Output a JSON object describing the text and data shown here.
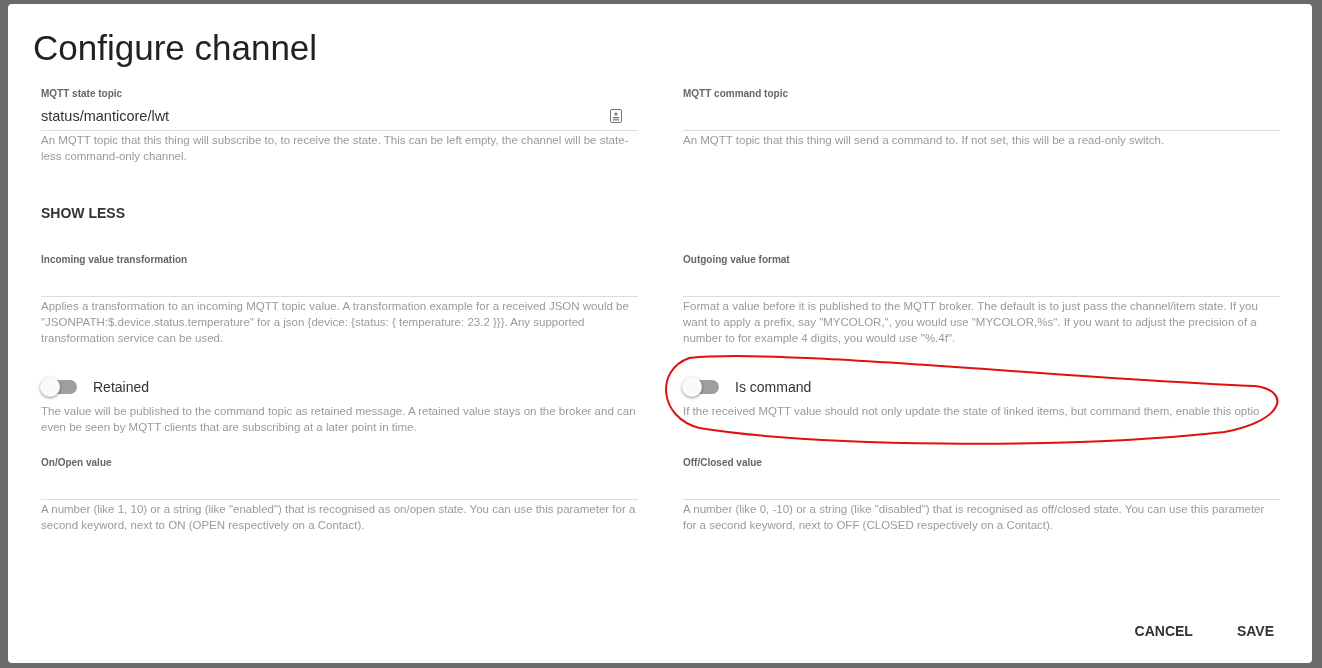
{
  "dialog": {
    "title": "Configure channel"
  },
  "top_fields": [
    {
      "kind": "text",
      "label": "MQTT state topic",
      "value": "status/manticore/lwt",
      "has_icon": true,
      "help": "An MQTT topic that this thing will subscribe to, to receive the state. This can be left empty, the channel will be state-less command-only channel."
    },
    {
      "kind": "text",
      "label": "MQTT command topic",
      "help": "An MQTT topic that this thing will send a command to. If not set, this will be a read-only switch."
    }
  ],
  "toggle_link": "SHOW LESS",
  "advanced_fields": [
    {
      "kind": "text",
      "label": "Incoming value transformation",
      "help": "Applies a transformation to an incoming MQTT topic value. A transformation example for a received JSON would be \"JSONPATH:$.device.status.temperature\" for a json {device: {status: { temperature: 23.2 }}}. Any supported transformation service can be used."
    },
    {
      "kind": "text",
      "label": "Outgoing value format",
      "help": "Format a value before it is published to the MQTT broker. The default is to just pass the channel/item state. If you want to apply a prefix, say \"MYCOLOR,\", you would use \"MYCOLOR,%s\". If you want to adjust the precision of a number to for example 4 digits, you would use \"%.4f\"."
    },
    {
      "kind": "switch",
      "label": "Retained",
      "on": false,
      "help": "The value will be published to the command topic as retained message. A retained value stays on the broker and can even be seen by MQTT clients that are subscribing at a later point in time."
    },
    {
      "kind": "switch",
      "label": "Is command",
      "on": false,
      "highlighted": true,
      "help": "If the received MQTT value should not only update the state of linked items, but command them, enable this optio"
    },
    {
      "kind": "text",
      "label": "On/Open value",
      "help": "A number (like 1, 10) or a string (like \"enabled\") that is recognised as on/open state. You can use this parameter for a second keyword, next to ON (OPEN respectively on a Contact)."
    },
    {
      "kind": "text",
      "label": "Off/Closed value",
      "help": "A number (like 0, -10) or a string (like \"disabled\") that is recognised as off/closed state. You can use this parameter for a second keyword, next to OFF (CLOSED respectively on a Contact)."
    }
  ],
  "buttons": [
    "CANCEL",
    "SAVE"
  ]
}
